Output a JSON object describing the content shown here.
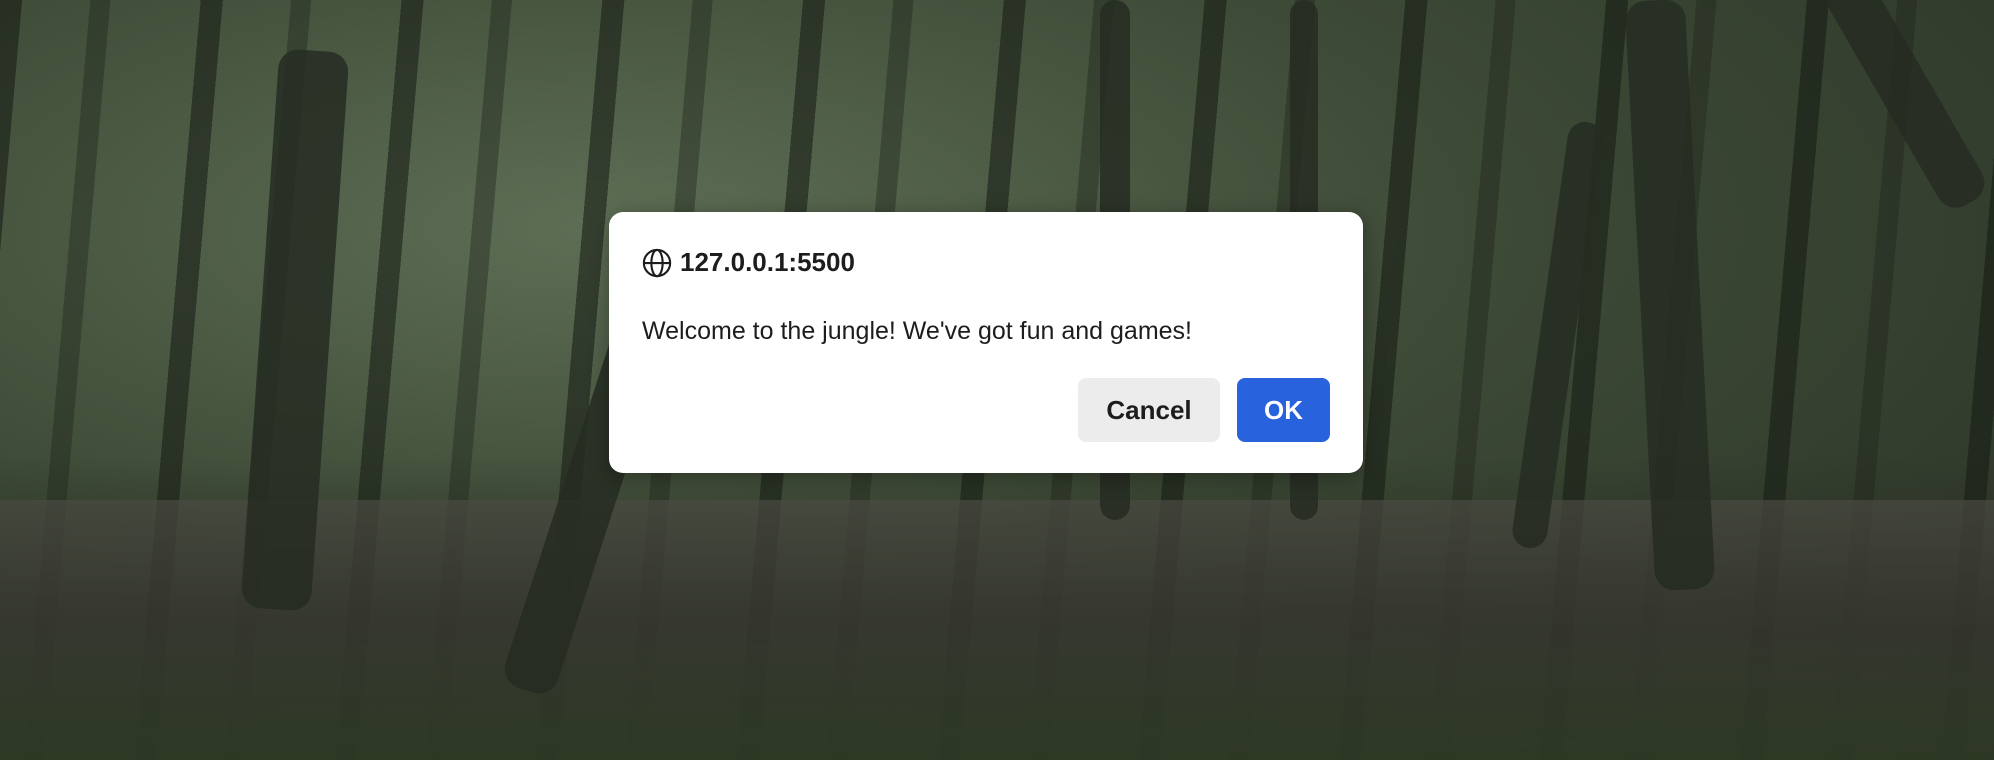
{
  "dialog": {
    "origin": "127.0.0.1:5500",
    "origin_icon": "globe-icon",
    "message": "Welcome to the jungle! We've got fun and games!",
    "cancel_label": "Cancel",
    "ok_label": "OK",
    "ok_color": "#2862dc"
  }
}
